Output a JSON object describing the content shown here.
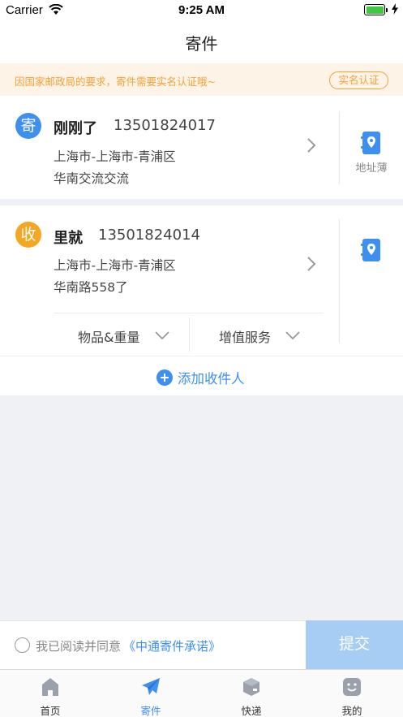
{
  "status_bar": {
    "carrier": "Carrier",
    "time": "9:25 AM"
  },
  "nav": {
    "title": "寄件"
  },
  "notice": {
    "text": "因国家邮政局的要求，寄件需要实名认证哦~",
    "button": "实名认证"
  },
  "sender": {
    "badge": "寄",
    "name": "刚刚了",
    "phone": "13501824017",
    "region": "上海市-上海市-青浦区",
    "street": "华南交流交流",
    "address_book_label": "地址薄"
  },
  "receiver": {
    "badge": "收",
    "name": "里就",
    "phone": "13501824014",
    "region": "上海市-上海市-青浦区",
    "street": "华南路558了",
    "options": [
      "物品&重量",
      "增值服务"
    ]
  },
  "add_receiver": {
    "label": "添加收件人"
  },
  "bottom": {
    "agree_text": "我已阅读并同意",
    "agree_link": "《中通寄件承诺》",
    "submit": "提交"
  },
  "tabs": [
    {
      "label": "首页",
      "icon": "home-icon"
    },
    {
      "label": "寄件",
      "icon": "paper-plane-icon",
      "active": true
    },
    {
      "label": "快递",
      "icon": "package-icon"
    },
    {
      "label": "我的",
      "icon": "profile-face-icon"
    }
  ],
  "colors": {
    "accent": "#3d8ff0",
    "sender_badge": "#3d8ff0",
    "receiver_badge": "#f5a623",
    "notice_text": "#f2a23a",
    "notice_bg": "#fdf3e6",
    "submit_disabled": "#a8cdf5"
  }
}
